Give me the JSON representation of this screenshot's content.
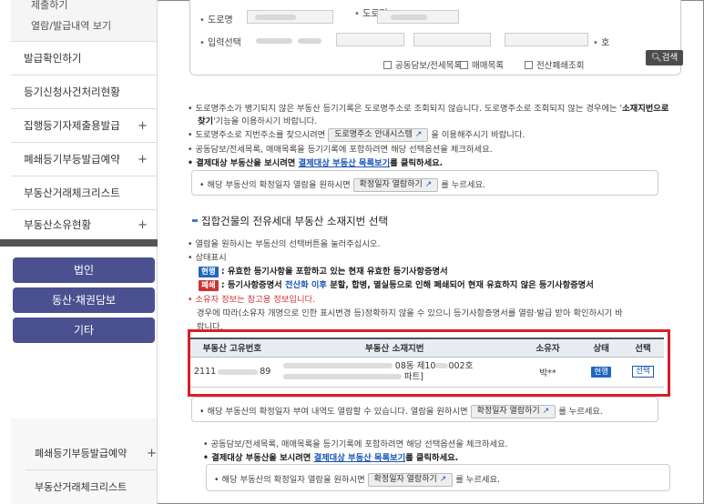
{
  "sidebar": {
    "sub_items": [
      "제출하기",
      "열람/발급내역 보기"
    ],
    "items": [
      {
        "label": "발급확인하기",
        "plus": ""
      },
      {
        "label": "등기신청사건처리현황",
        "plus": ""
      },
      {
        "label": "집행등기자제출용발급",
        "plus": "+"
      },
      {
        "label": "폐쇄등기부등발급예약",
        "plus": "+"
      },
      {
        "label": "부동산거래체크리스트",
        "plus": ""
      },
      {
        "label": "부동산소유현황",
        "plus": "+"
      }
    ],
    "category_buttons": [
      "법인",
      "동산·채권담보",
      "기타"
    ],
    "lower_items": [
      {
        "label": "폐쇄등기부등발급예약",
        "plus": "+"
      },
      {
        "label": "부동산거래체크리스트",
        "plus": ""
      }
    ]
  },
  "search": {
    "road_label": "도로명",
    "road_label2": "도로명",
    "input_label": "입력선택",
    "unit_suffix": "호",
    "checkboxes": [
      "공동담보/전세목록",
      "매매목록",
      "전산폐쇄조회"
    ],
    "search_button": "검색",
    "search_icon": "magnifier-icon"
  },
  "notes": {
    "n1a": "도로명주소가 병기되지 않은 부동산 등기기록은 도로명주소로 조회되지 않습니다. 도로명주소로 조회되지 않는 경우에는 '",
    "n1b": "소재지번으로",
    "n1c": "찾기",
    "n1d": "'기능을 이용하시기 바랍니다.",
    "n2a": "도로명주소로 지번주소를 찾으시려면",
    "n2btn": "도로명주소 안내시스템",
    "n2b": "을 이용해주시기 바랍니다.",
    "n3": "공동담보/전세목록, 매매목록을 등기기록에 포함하려면 해당 선택옵션을 체크하세요.",
    "n4a": "결제대상 부동산을 보시려면",
    "n4link": "결제대상 부동산 목록보기",
    "n4b": "를 클릭하세요.",
    "box1a": "해당 부동산의 확정일자 열람을 원하시면",
    "box1btn": "확정일자 열람하기",
    "box1b": "를 누르세요."
  },
  "section": {
    "title": "집합건물의 전유세대 부동산 소재지번 선택",
    "i1": "열람을 원하시는 부동산의 선택버튼을 눌러주십시오.",
    "i2": "상태표시",
    "cur_badge": "현행",
    "cur_text": ": 유효한 등기사항을 포함하고 있는 현재 유효한 등기사항증명서",
    "closed_badge": "폐쇄",
    "closed_a": ": 등기사항증명서",
    "closed_blue": "전산화 이후",
    "closed_b": "분할, 합병, 멸실등으로 인해 폐쇄되어 현재 유효하지 않은 등기사항증명서",
    "i3": "소유자 정보는 참고용 정보입니다.",
    "i4a": "경우에 따라(소유자 개명으로 인한 표시변경 등)정확하지 않을 수 있으니 등기사항증명서를 열람·발급 받아 확인하시기 바",
    "i4b": "랍니다."
  },
  "table": {
    "headers": [
      "부동산 고유번호",
      "부동산 소재지번",
      "소유자",
      "상태",
      "선택"
    ],
    "row": {
      "id_prefix": "2111",
      "id_suffix": "89",
      "addr_a": "08동 제10",
      "addr_b": "002호",
      "addr_c": "파트]",
      "owner": "박**",
      "status": "현행",
      "select": "선택"
    }
  },
  "box2": {
    "a": "해당 부동산의 확정일자 부여 내역도 열람할 수 있습니다. 열람을 원하시면",
    "btn": "확정일자 열람하기",
    "b": "를 누르세요."
  },
  "lower": {
    "n1": "공동담보/전세목록, 매매목록을 등기기록에 포함하려면 해당 선택옵션을 체크하세요.",
    "n2a": "결제대상 부동산을 보시려면",
    "n2link": "결제대상 부동산 목록보기",
    "n2b": "를 클릭하세요.",
    "boxa": "해당 부동산의 확정일자 열람을 원하시면",
    "boxbtn": "확정일자 열람하기",
    "boxb": "를 누르세요."
  },
  "colors": {
    "sidebar_button": "#4b5190",
    "highlight": "#d81f26",
    "link": "#1a56b8"
  }
}
